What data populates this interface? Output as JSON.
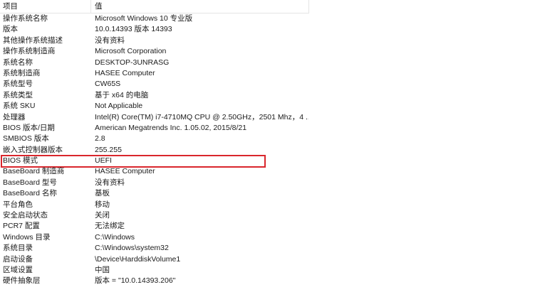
{
  "columns": {
    "item": "项目",
    "value": "值"
  },
  "rows": [
    {
      "item": "操作系统名称",
      "value": "Microsoft Windows 10 专业版"
    },
    {
      "item": "版本",
      "value": "10.0.14393 版本 14393"
    },
    {
      "item": "其他操作系统描述",
      "value": "没有资料"
    },
    {
      "item": "操作系统制造商",
      "value": "Microsoft Corporation"
    },
    {
      "item": "系统名称",
      "value": "DESKTOP-3UNRASG"
    },
    {
      "item": "系统制造商",
      "value": "HASEE Computer"
    },
    {
      "item": "系统型号",
      "value": "CW65S"
    },
    {
      "item": "系统类型",
      "value": "基于 x64 的电脑"
    },
    {
      "item": "系统 SKU",
      "value": "Not Applicable"
    },
    {
      "item": "处理器",
      "value": "Intel(R) Core(TM) i7-4710MQ CPU @ 2.50GHz，2501 Mhz，4 ..."
    },
    {
      "item": "BIOS 版本/日期",
      "value": "American Megatrends Inc. 1.05.02, 2015/8/21"
    },
    {
      "item": "SMBIOS 版本",
      "value": "2.8"
    },
    {
      "item": "嵌入式控制器版本",
      "value": "255.255"
    },
    {
      "item": "BIOS 模式",
      "value": "UEFI"
    },
    {
      "item": "BaseBoard 制造商",
      "value": "HASEE Computer"
    },
    {
      "item": "BaseBoard 型号",
      "value": "没有资料"
    },
    {
      "item": "BaseBoard 名称",
      "value": "基板"
    },
    {
      "item": "平台角色",
      "value": "移动"
    },
    {
      "item": "安全启动状态",
      "value": "关闭"
    },
    {
      "item": "PCR7 配置",
      "value": "无法绑定"
    },
    {
      "item": "Windows 目录",
      "value": "C:\\Windows"
    },
    {
      "item": "系统目录",
      "value": "C:\\Windows\\system32"
    },
    {
      "item": "启动设备",
      "value": "\\Device\\HarddiskVolume1"
    },
    {
      "item": "区域设置",
      "value": "中国"
    },
    {
      "item": "硬件抽象层",
      "value": "版本 = \"10.0.14393.206\""
    }
  ],
  "highlight_color": "#d9262c"
}
